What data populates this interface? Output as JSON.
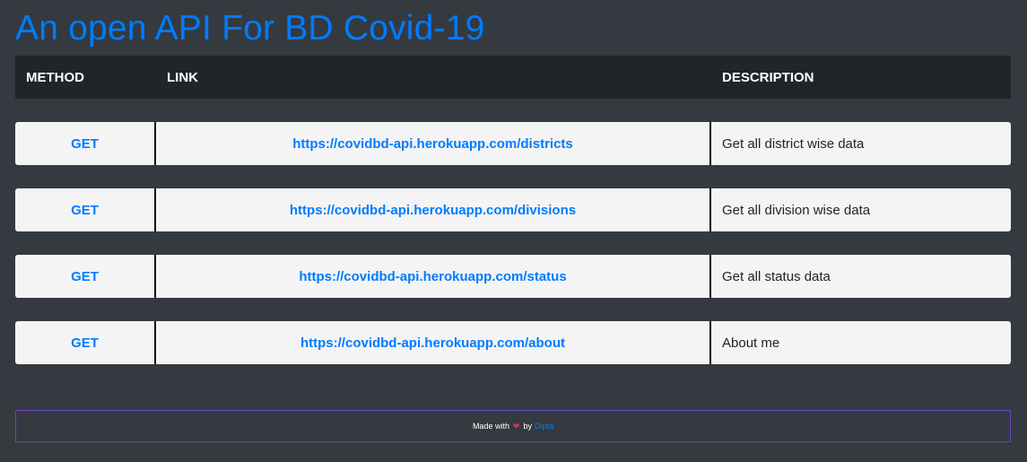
{
  "header": {
    "title": "An open API For BD Covid-19"
  },
  "table": {
    "columns": {
      "method": "METHOD",
      "link": "LINK",
      "description": "DESCRIPTION"
    },
    "rows": [
      {
        "method": "GET",
        "link": "https://covidbd-api.herokuapp.com/districts",
        "description": "Get all district wise data"
      },
      {
        "method": "GET",
        "link": "https://covidbd-api.herokuapp.com/divisions",
        "description": "Get all division wise data"
      },
      {
        "method": "GET",
        "link": "https://covidbd-api.herokuapp.com/status",
        "description": "Get all status data"
      },
      {
        "method": "GET",
        "link": "https://covidbd-api.herokuapp.com/about",
        "description": "About me"
      }
    ]
  },
  "footer": {
    "made_with": "Made with",
    "heart_icon": "heart-icon",
    "by": "by",
    "author": "Dipta"
  },
  "colors": {
    "background": "#343a40",
    "accent": "#007bff",
    "header_bg": "#212529",
    "row_bg": "#f4f4f5",
    "footer_border": "#6f42c1",
    "heart": "#dc3545"
  }
}
